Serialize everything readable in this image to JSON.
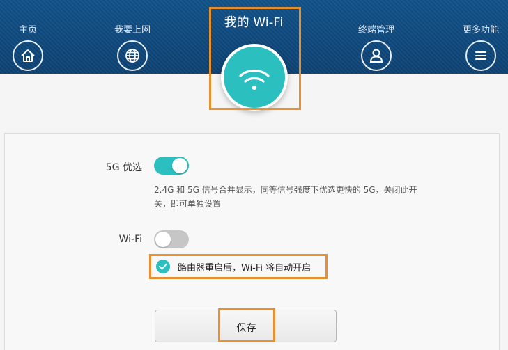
{
  "nav": {
    "items": [
      {
        "label": "主页",
        "icon": "home-icon"
      },
      {
        "label": "我要上网",
        "icon": "globe-icon"
      },
      {
        "label": "我的 Wi-Fi",
        "icon": "wifi-icon",
        "active": true
      },
      {
        "label": "终端管理",
        "icon": "user-icon"
      },
      {
        "label": "更多功能",
        "icon": "menu-icon"
      }
    ]
  },
  "settings": {
    "band_5g": {
      "label": "5G 优选",
      "enabled": true,
      "description": "2.4G 和 5G 信号合并显示，同等信号强度下优选更快的 5G，关闭此开关，即可单独设置"
    },
    "wifi": {
      "label": "Wi-Fi",
      "enabled": false,
      "auto_enable_checked": true,
      "auto_enable_label": "路由器重启后，Wi-Fi 将自动开启"
    },
    "save_label": "保存"
  },
  "colors": {
    "header": "#0f4f86",
    "accent": "#2bbfbf",
    "highlight": "#e8902e"
  }
}
